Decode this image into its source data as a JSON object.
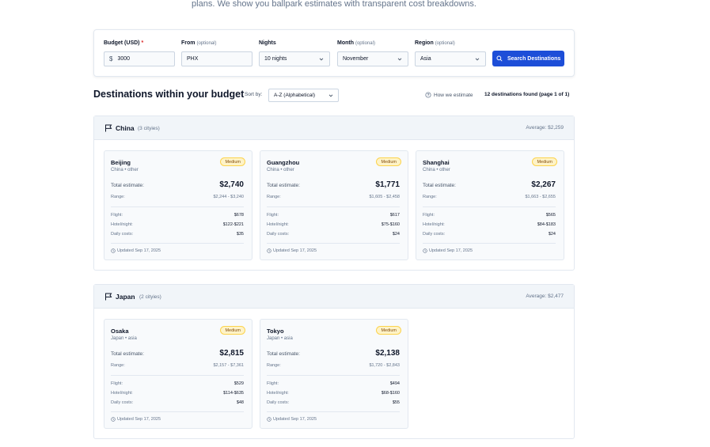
{
  "page": {
    "subtitle": "plans. We show you ballpark estimates with transparent cost breakdowns."
  },
  "search": {
    "budget": {
      "label": "Budget (USD)",
      "required_mark": "*",
      "currency": "$",
      "value": "3000"
    },
    "from": {
      "label": "From",
      "optional": "(optional)",
      "value": "PHX"
    },
    "nights": {
      "label": "Nights",
      "value": "10 nights"
    },
    "month": {
      "label": "Month",
      "optional": "(optional)",
      "value": "November"
    },
    "region": {
      "label": "Region",
      "optional": "(optional)",
      "value": "Asia"
    },
    "button_label": "Search Destinations",
    "button_icon": "search-icon",
    "accent_color": "#1d4ed8"
  },
  "results": {
    "title": "Destinations within your budget",
    "sort_label": "Sort by:",
    "sort_value": "A-Z (Alphabetical)",
    "how_link": "How we estimate",
    "count_text": "12 destinations found (page 1 of 1)"
  },
  "groups": [
    {
      "name": "China",
      "count": "(3 cityies)",
      "average": "Average: $2,259",
      "cards": [
        {
          "city": "Beijing",
          "region": "China • other",
          "badge": "Medium",
          "total_label": "Total estimate:",
          "total": "$2,740",
          "range_label": "Range:",
          "range": "$2,244 - $3,240",
          "flight_label": "Flight:",
          "flight": "$678",
          "hotel_label": "Hotel/night:",
          "hotel": "$122-$221",
          "daily_label": "Daily costs:",
          "daily": "$35",
          "updated": "Updated Sep 17, 2025"
        },
        {
          "city": "Guangzhou",
          "region": "China • other",
          "badge": "Medium",
          "total_label": "Total estimate:",
          "total": "$1,771",
          "range_label": "Range:",
          "range": "$1,605 - $2,458",
          "flight_label": "Flight:",
          "flight": "$617",
          "hotel_label": "Hotel/night:",
          "hotel": "$75-$160",
          "daily_label": "Daily costs:",
          "daily": "$24",
          "updated": "Updated Sep 17, 2025"
        },
        {
          "city": "Shanghai",
          "region": "China • other",
          "badge": "Medium",
          "total_label": "Total estimate:",
          "total": "$2,267",
          "range_label": "Range:",
          "range": "$1,663 - $2,655",
          "flight_label": "Flight:",
          "flight": "$565",
          "hotel_label": "Hotel/night:",
          "hotel": "$84-$183",
          "daily_label": "Daily costs:",
          "daily": "$24",
          "updated": "Updated Sep 17, 2025"
        }
      ]
    },
    {
      "name": "Japan",
      "count": "(2 cityies)",
      "average": "Average: $2,477",
      "cards": [
        {
          "city": "Osaka",
          "region": "Japan • asia",
          "badge": "Medium",
          "total_label": "Total estimate:",
          "total": "$2,815",
          "range_label": "Range:",
          "range": "$2,157 - $7,361",
          "flight_label": "Flight:",
          "flight": "$529",
          "hotel_label": "Hotel/night:",
          "hotel": "$114-$635",
          "daily_label": "Daily costs:",
          "daily": "$48",
          "updated": "Updated Sep 17, 2025"
        },
        {
          "city": "Tokyo",
          "region": "Japan • asia",
          "badge": "Medium",
          "total_label": "Total estimate:",
          "total": "$2,138",
          "range_label": "Range:",
          "range": "$1,720 - $2,843",
          "flight_label": "Flight:",
          "flight": "$494",
          "hotel_label": "Hotel/night:",
          "hotel": "$68-$160",
          "daily_label": "Daily costs:",
          "daily": "$55",
          "updated": "Updated Sep 17, 2025"
        }
      ]
    }
  ]
}
